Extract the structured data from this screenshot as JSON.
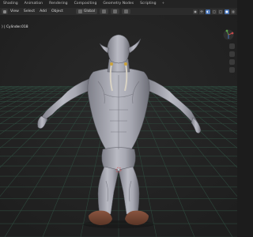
{
  "workspace_tabs": [
    "Shading",
    "Animation",
    "Rendering",
    "Compositing",
    "Geometry Nodes",
    "Scripting"
  ],
  "workspace_add": "+",
  "header": {
    "menus": [
      "View",
      "Select",
      "Add",
      "Object"
    ],
    "orientation": "Global"
  },
  "viewport": {
    "object_label": ") | Cylinder.018"
  },
  "colors": {
    "background": "#1c1c1c",
    "grid_line": "#2e4a3e",
    "accent": "#4772b3"
  }
}
